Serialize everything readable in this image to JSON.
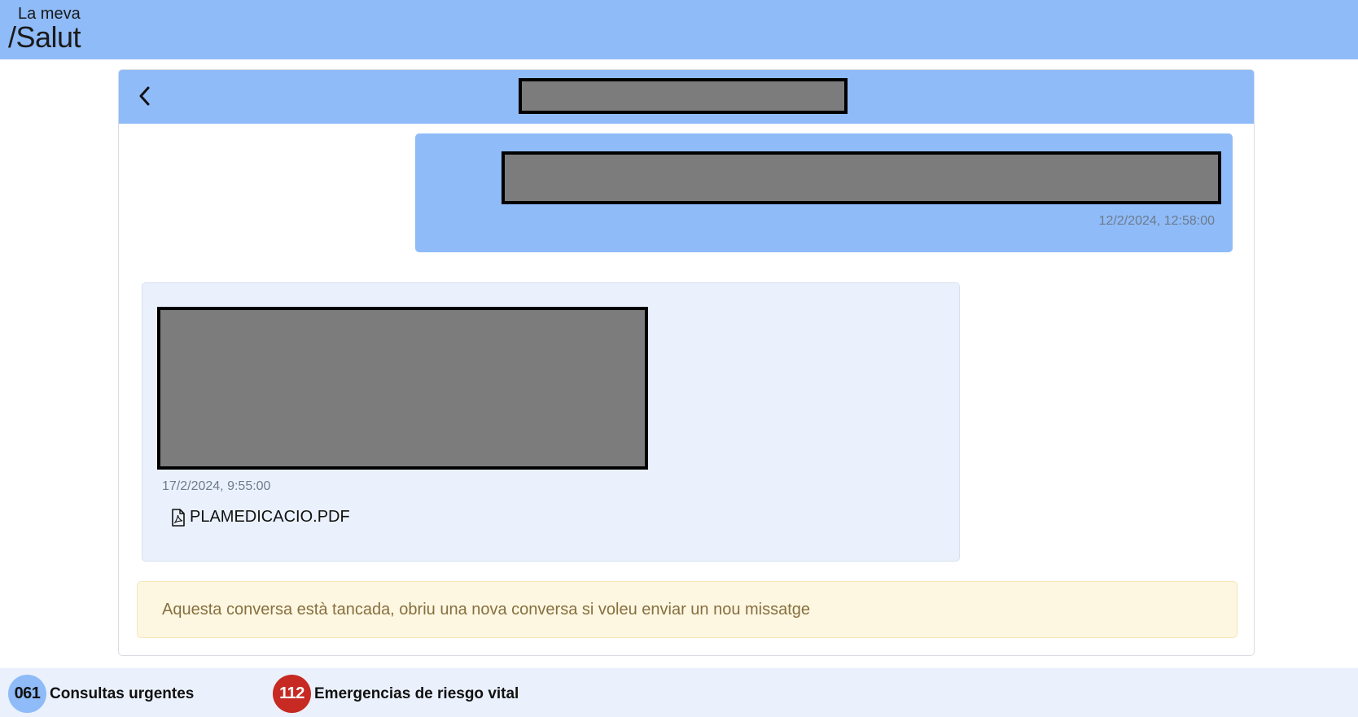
{
  "header": {
    "logo_line1": "La meva",
    "logo_line2": "/Salut",
    "brand_color": "#8fbbf8"
  },
  "conversation": {
    "back_icon": "chevron-left-icon",
    "title": "",
    "messages": [
      {
        "direction": "outgoing",
        "text": "",
        "timestamp": "12/2/2024, 12:58:00"
      },
      {
        "direction": "incoming",
        "text": "",
        "timestamp": "17/2/2024, 9:55:00",
        "attachment": {
          "icon": "pdf-file-icon",
          "name": "PLAMEDICACIO.PDF"
        }
      }
    ],
    "closed_notice": "Aquesta conversa està tancada, obriu una nova conversa si voleu enviar un nou missatge"
  },
  "footer": {
    "items": [
      {
        "badge": "061",
        "label": "Consultas urgentes",
        "color": "#8fbbf8"
      },
      {
        "badge": "112",
        "label": "Emergencias de riesgo vital",
        "color": "#c62a22"
      }
    ]
  }
}
